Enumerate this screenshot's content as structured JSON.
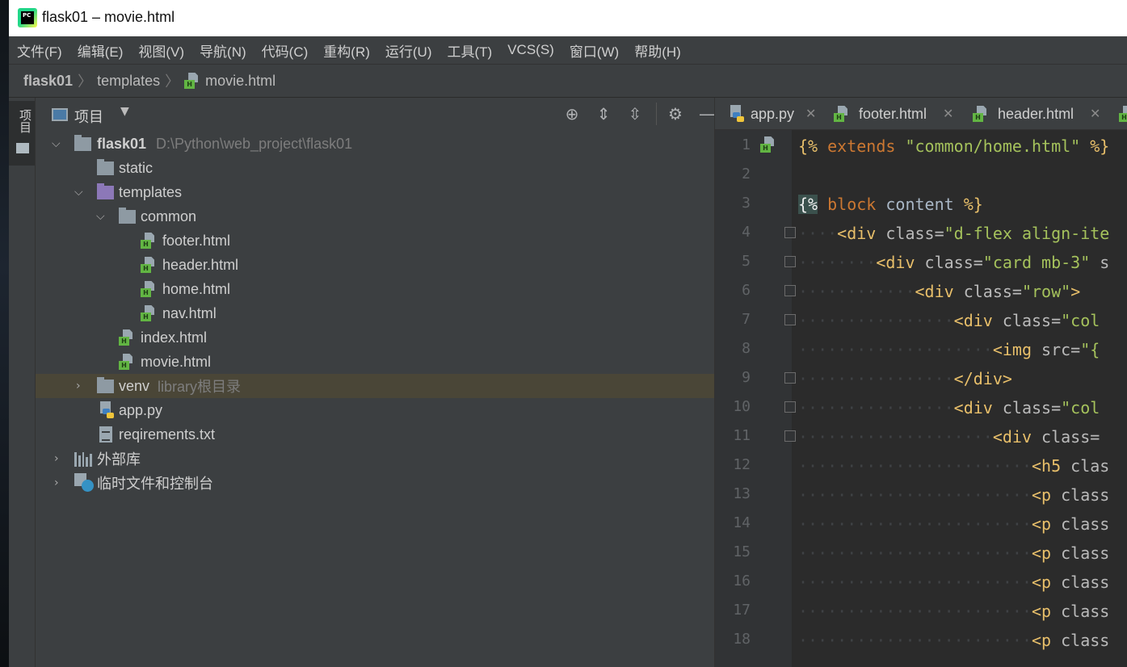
{
  "window": {
    "title": "flask01 – movie.html",
    "app_icon_text": "PC"
  },
  "menu": [
    "文件(F)",
    "编辑(E)",
    "视图(V)",
    "导航(N)",
    "代码(C)",
    "重构(R)",
    "运行(U)",
    "工具(T)",
    "VCS(S)",
    "窗口(W)",
    "帮助(H)"
  ],
  "breadcrumb": {
    "project": "flask01",
    "folder": "templates",
    "file": "movie.html"
  },
  "toolstrip": {
    "project_tab": "项目"
  },
  "project_panel": {
    "title": "项目",
    "tree": {
      "root_name": "flask01",
      "root_path": "D:\\Python\\web_project\\flask01",
      "static": "static",
      "templates": "templates",
      "common": "common",
      "footer": "footer.html",
      "header": "header.html",
      "home": "home.html",
      "nav": "nav.html",
      "index": "index.html",
      "movie": "movie.html",
      "venv": "venv",
      "venv_hint": "library根目录",
      "app": "app.py",
      "req": "reqirements.txt",
      "external": "外部库",
      "scratches": "临时文件和控制台"
    }
  },
  "editor": {
    "tabs": [
      "app.py",
      "footer.html",
      "header.html"
    ],
    "line_numbers": [
      "1",
      "2",
      "3",
      "4",
      "5",
      "6",
      "7",
      "8",
      "9",
      "10",
      "11",
      "12",
      "13",
      "14",
      "15",
      "16",
      "17",
      "18"
    ],
    "lines": {
      "l1_a": "{%",
      "l1_b": " extends ",
      "l1_c": "\"common/home.html\"",
      "l1_d": " %}",
      "l3_a": "{%",
      "l3_b": " block ",
      "l3_c": "content",
      "l3_d": " %}",
      "l4_tag": "<div",
      "l4_attr": " class=",
      "l4_val": "\"d-flex align-ite",
      "l5_tag": "<div",
      "l5_attr": " class=",
      "l5_val": "\"card mb-3\"",
      "l5_rest": " s",
      "l6_tag": "<div",
      "l6_attr": " class=",
      "l6_val": "\"row\"",
      "l6_end": ">",
      "l7_tag": "<div",
      "l7_attr": " class=",
      "l7_val": "\"col",
      "l8_tag": "<img",
      "l8_attr": " src=",
      "l8_val": "\"{",
      "l9_tag": "</div>",
      "l10_tag": "<div",
      "l10_attr": " class=",
      "l10_val": "\"col",
      "l11_tag": "<div",
      "l11_attr": " class=",
      "l12_tag": "<h5",
      "l12_attr": " clas",
      "p_tag": "<p",
      "p_attr": " class"
    }
  },
  "colors": {
    "background": "#2b2b2b",
    "panel": "#3c3f41",
    "tag": "#e8bf6a",
    "string": "#a5c25c",
    "selection": "#4a4637"
  }
}
